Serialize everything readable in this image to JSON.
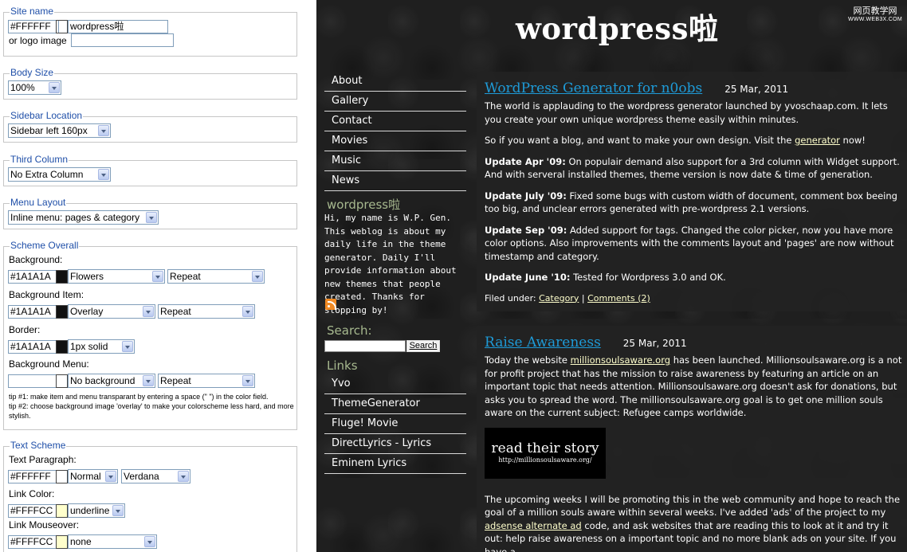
{
  "form": {
    "site_name": {
      "legend": "Site name",
      "color": "#FFFFFF",
      "swatch": "#ffffff",
      "value": "wordpress啦",
      "logo_label": "or logo image",
      "logo_value": ""
    },
    "body_size": {
      "legend": "Body Size",
      "value": "100%"
    },
    "sidebar_location": {
      "legend": "Sidebar Location",
      "value": "Sidebar left 160px"
    },
    "third_column": {
      "legend": "Third Column",
      "value": "No Extra Column"
    },
    "menu_layout": {
      "legend": "Menu Layout",
      "value": "Inline menu: pages & category"
    },
    "scheme_overall": {
      "legend": "Scheme Overall",
      "background": {
        "label": "Background:",
        "color": "#1A1A1A",
        "swatch": "#111111",
        "image": "Flowers",
        "repeat": "Repeat"
      },
      "background_item": {
        "label": "Background Item:",
        "color": "#1A1A1A",
        "swatch": "#111111",
        "image": "Overlay",
        "repeat": "Repeat"
      },
      "border": {
        "label": "Border:",
        "color": "#1A1A1A",
        "swatch": "#111111",
        "style": "1px solid"
      },
      "background_menu": {
        "label": "Background Menu:",
        "color": "",
        "swatch": "#ffffff",
        "image": "No background",
        "repeat": "Repeat"
      },
      "tip1": "tip #1: make item and menu transparant by entering a space (\" \") in the color field.",
      "tip2": "tip #2: choose background image 'overlay' to make your colorscheme less hard, and more stylish."
    },
    "text_scheme": {
      "legend": "Text Scheme",
      "paragraph": {
        "label": "Text Paragraph:",
        "color": "#FFFFFF",
        "swatch": "#ffffff",
        "weight": "Normal",
        "font": "Verdana"
      },
      "link": {
        "label": "Link Color:",
        "color": "#FFFFCC",
        "swatch": "#ffffcc",
        "decoration": "underline"
      },
      "mouseover": {
        "label": "Link Mouseover:",
        "color": "#FFFFCC",
        "swatch": "#ffffcc",
        "decoration": "none"
      }
    }
  },
  "blog": {
    "title": "wordpress啦",
    "watermark": {
      "line1": "网页教学网",
      "line2": "WWW.WEB3X.COM"
    },
    "nav": [
      "About",
      "Gallery",
      "Contact",
      "Movies",
      "Music",
      "News"
    ],
    "sidebar": {
      "title": "wordpress啦",
      "text": "Hi, my name is W.P. Gen. This weblog is about my daily life in the theme generator. Daily I'll provide information about new themes that people created. Thanks for stopping by!",
      "search_title": "Search:",
      "search_button": "Search",
      "links_title": "Links",
      "links": [
        "Yvo",
        "ThemeGenerator",
        "Fluge! Movie",
        "DirectLyrics - Lyrics",
        "Eminem Lyrics"
      ]
    },
    "post1": {
      "title": "WordPress Generator for n0obs",
      "date": "25 Mar, 2011",
      "p1": "The world is applauding to the wordpress generator launched by yvoschaap.com. It lets you create your own unique wordpress theme easily within minutes.",
      "p2_pre": "So if you want a blog, and want to make your own design. Visit the ",
      "p2_link": "generator",
      "p2_post": " now!",
      "u1_b": "Update Apr '09:",
      "u1": " On populair demand also support for a 3rd column with Widget support. And with serveral installed themes, theme version is now date & time of generation.",
      "u2_b": "Update July '09:",
      "u2": " Fixed some bugs with custom width of document, comment box beeing too big, and unclear errors generated with pre-wordpress 2.1 versions.",
      "u3_b": "Update Sep '09:",
      "u3": " Added support for tags. Changed the color picker, now you have more color options. Also improvements with the comments layout and 'pages' are now without timestamp and category.",
      "u4_b": "Update June '10:",
      "u4": " Tested for Wordpress 3.0 and OK.",
      "filed_label": "Filed under: ",
      "category": "Category",
      "sep": " | ",
      "comments": "Comments (2)"
    },
    "post2": {
      "title": "Raise Awareness",
      "date": "25 Mar, 2011",
      "p1_pre": "Today the website ",
      "p1_link": "millionsoulsaware.org",
      "p1_post": " has been launched. Millionsoulsaware.org is a not for profit project that has the mission to raise awareness by featuring an article on an important topic that needs attention. Millionsoulsaware.org doesn't ask for donations, but asks you to spread the word. The millionsoulsaware.org goal is to get one million souls aware on the current subject: Refugee camps worldwide.",
      "banner_big": "read their story",
      "banner_small": "http://millionsoulsaware.org/",
      "p2_pre": "The upcoming weeks I will be promoting this in the web community and hope to reach the goal of a million souls aware within several weeks. I've added 'ads' of the project to my ",
      "p2_link": "adsense alternate ad",
      "p2_post": " code, and ask websites that are reading this to look at it and try it out: help raise awareness on a important topic and no more blank ads on your site. If you have a"
    }
  }
}
